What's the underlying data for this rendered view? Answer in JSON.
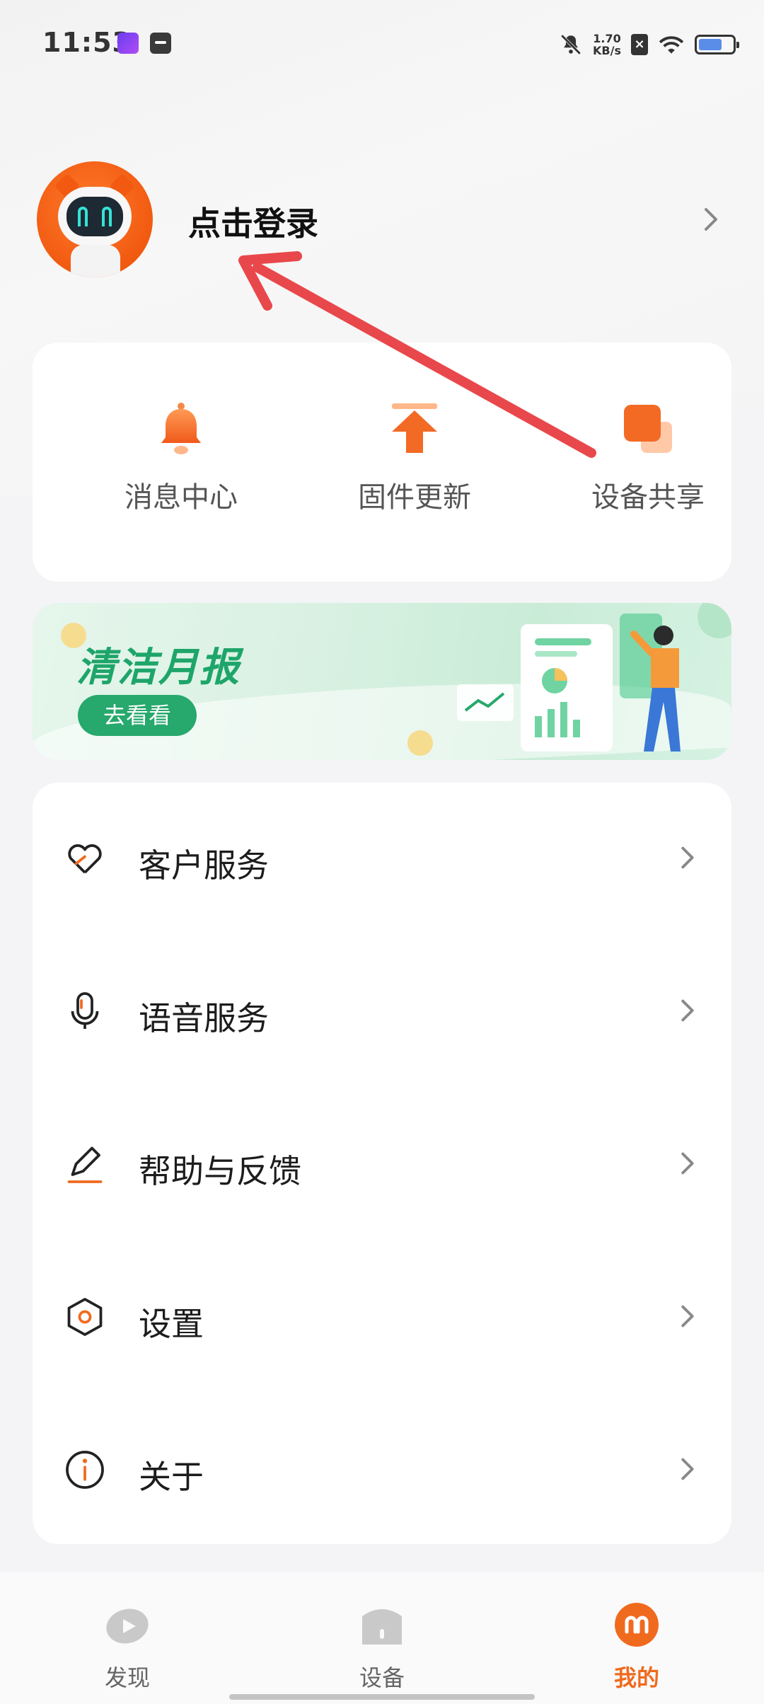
{
  "status_bar": {
    "time": "11:53",
    "net_speed_value": "1.70",
    "net_speed_unit": "KB/s",
    "sim_label": "×"
  },
  "profile": {
    "login_text": "点击登录"
  },
  "quick_actions": [
    {
      "label": "消息中心",
      "icon": "bell-icon"
    },
    {
      "label": "固件更新",
      "icon": "upload-arrow-icon"
    },
    {
      "label": "设备共享",
      "icon": "share-squares-icon"
    }
  ],
  "banner": {
    "title": "清洁月报",
    "button": "去看看"
  },
  "menu": [
    {
      "label": "客户服务",
      "icon": "heart-hand-icon"
    },
    {
      "label": "语音服务",
      "icon": "microphone-icon"
    },
    {
      "label": "帮助与反馈",
      "icon": "pencil-icon"
    },
    {
      "label": "设置",
      "icon": "hexagon-gear-icon"
    },
    {
      "label": "关于",
      "icon": "info-icon"
    }
  ],
  "tabs": [
    {
      "label": "发现",
      "icon": "discover-play-icon",
      "active": false
    },
    {
      "label": "设备",
      "icon": "device-home-icon",
      "active": false
    },
    {
      "label": "我的",
      "icon": "profile-robot-icon",
      "active": true
    }
  ],
  "colors": {
    "accent": "#f06a1e",
    "banner_green": "#27a86d",
    "annotation_red": "#e8484b"
  }
}
